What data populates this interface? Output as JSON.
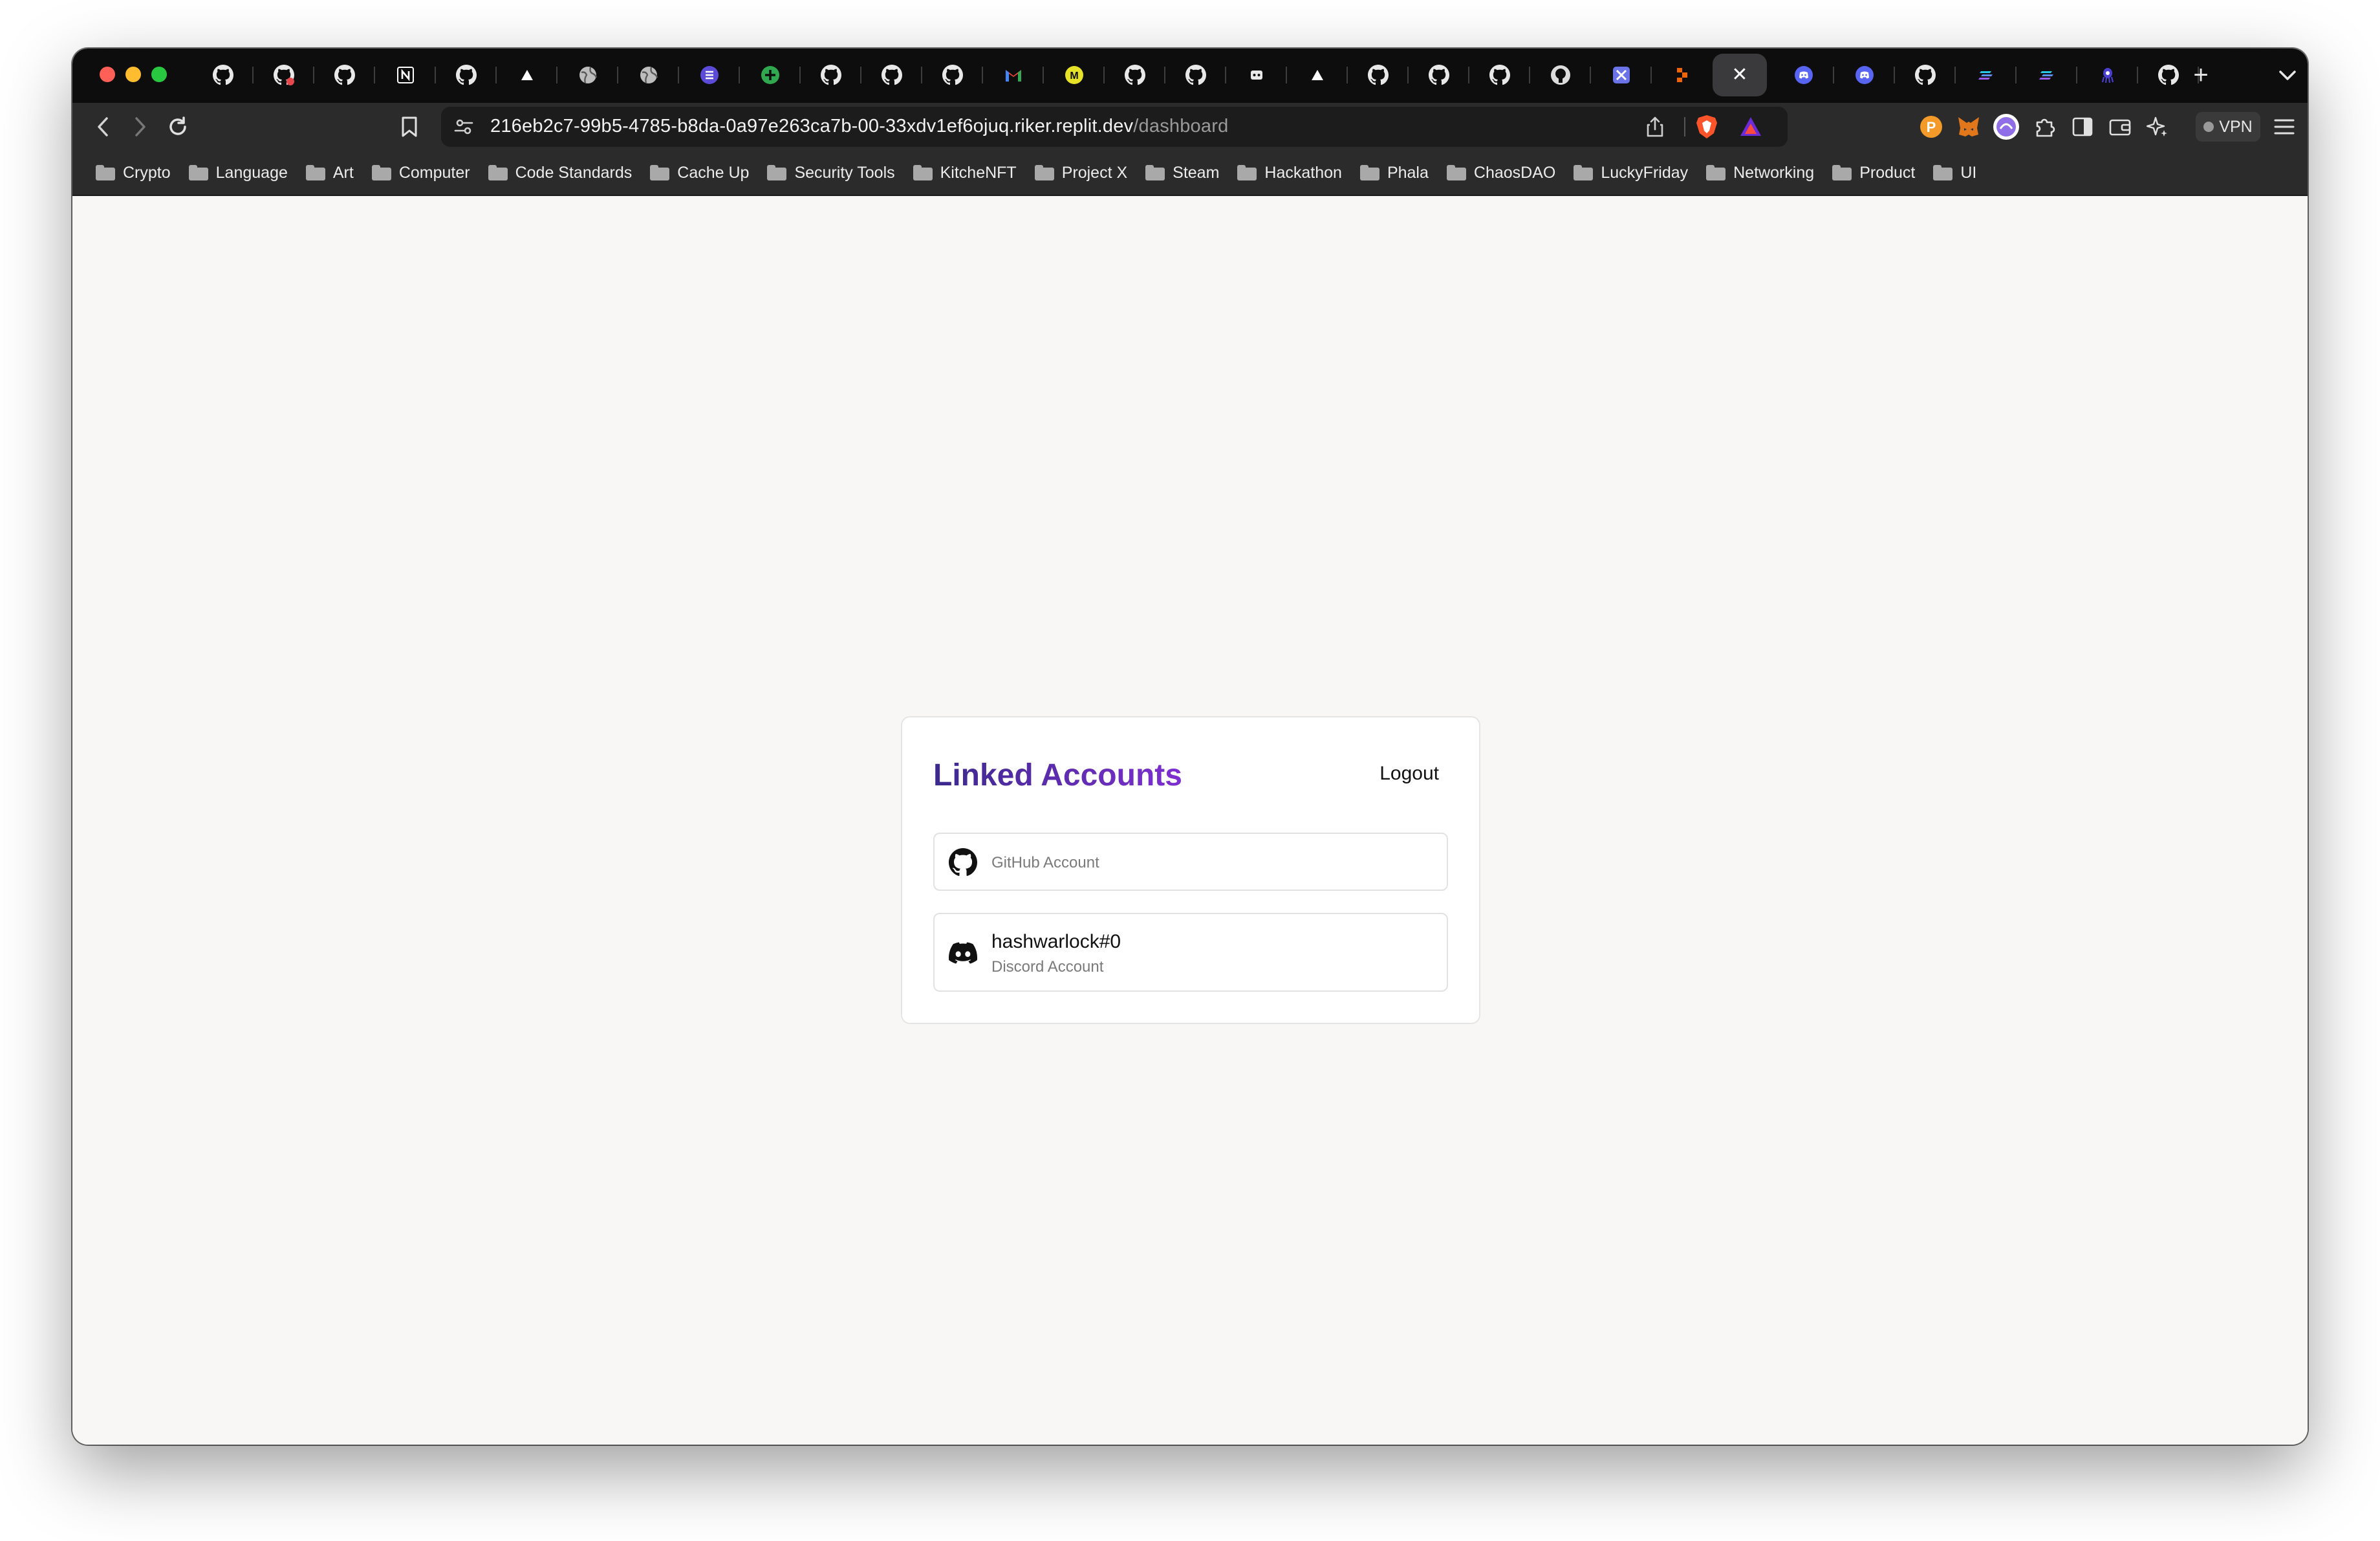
{
  "browser": {
    "tabs": [
      {
        "icon": "github-icon"
      },
      {
        "icon": "github-error-icon"
      },
      {
        "icon": "github-icon"
      },
      {
        "icon": "notion-icon",
        "glyph": "N"
      },
      {
        "icon": "github-icon"
      },
      {
        "icon": "triangle-icon",
        "glyph": "▲"
      },
      {
        "icon": "globe-icon"
      },
      {
        "icon": "globe-icon"
      },
      {
        "icon": "list-app-icon"
      },
      {
        "icon": "green-plus-icon"
      },
      {
        "icon": "github-icon"
      },
      {
        "icon": "github-icon"
      },
      {
        "icon": "github-icon"
      },
      {
        "icon": "gmail-icon",
        "glyph": "M"
      },
      {
        "icon": "m-yellow-icon",
        "glyph": "M"
      },
      {
        "icon": "github-icon"
      },
      {
        "icon": "github-icon"
      },
      {
        "icon": "bot-icon"
      },
      {
        "icon": "triangle-icon",
        "glyph": "▲"
      },
      {
        "icon": "github-icon"
      },
      {
        "icon": "github-icon"
      },
      {
        "icon": "github-icon"
      },
      {
        "icon": "github-light-icon"
      },
      {
        "icon": "tools-icon"
      },
      {
        "icon": "replit-icon"
      },
      {
        "icon": "close-icon",
        "glyph": "✕",
        "active": true
      },
      {
        "icon": "discord-icon"
      },
      {
        "icon": "discord-icon"
      },
      {
        "icon": "github-icon"
      },
      {
        "icon": "stack-icon"
      },
      {
        "icon": "stack-icon"
      },
      {
        "icon": "octopus-icon"
      },
      {
        "icon": "github-icon"
      }
    ],
    "new_tab_glyph": "+",
    "url": {
      "host": "216eb2c7-99b5-4785-b8da-0a97e263ca7b-00-33xdv1ef6ojuq.riker.replit.dev",
      "path": "/dashboard"
    },
    "vpn_label": "VPN",
    "bookmarks": [
      "Crypto",
      "Language",
      "Art",
      "Computer",
      "Code Standards",
      "Cache Up",
      "Security Tools",
      "KitcheNFT",
      "Project X",
      "Steam",
      "Hackathon",
      "Phala",
      "ChaosDAO",
      "LuckyFriday",
      "Networking",
      "Product",
      "UI"
    ],
    "colors": {
      "tabbar": "#0d0d0d",
      "toolbar": "#2b2b2b",
      "traffic_red": "#fe5f57",
      "traffic_yellow": "#febc2e",
      "traffic_green": "#28c840"
    }
  },
  "page": {
    "title": "Linked Accounts",
    "logout_label": "Logout",
    "accounts": [
      {
        "provider": "github",
        "icon": "github-icon",
        "name": "",
        "type_label": "GitHub Account"
      },
      {
        "provider": "discord",
        "icon": "discord-icon",
        "name": "hashwarlock#0",
        "type_label": "Discord Account"
      }
    ],
    "colors": {
      "title_gradient_start": "#3b2a8c",
      "title_gradient_end": "#7e2fd0",
      "background": "#f8f7f6"
    }
  }
}
